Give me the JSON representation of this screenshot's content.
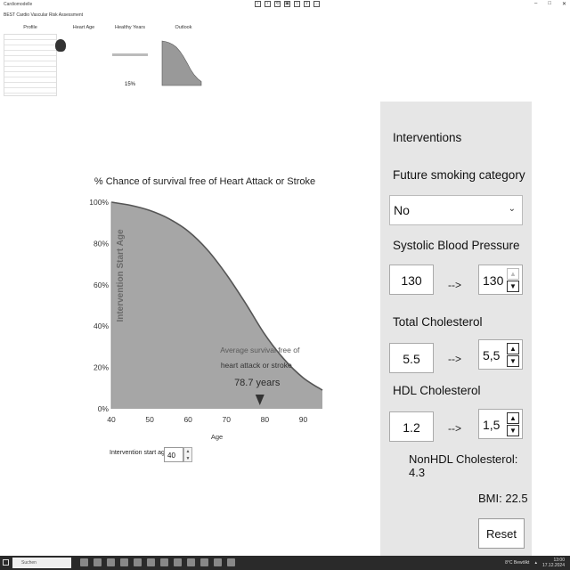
{
  "window": {
    "title": "Cardiomodelle",
    "subtitle": "BEST Cardio Vascular Risk Assessment"
  },
  "tabs": [
    {
      "label": "Profile"
    },
    {
      "label": "Heart Age"
    },
    {
      "label": "Healthy Years"
    },
    {
      "label": "Outlook"
    }
  ],
  "healthy_years": {
    "percent": "15%"
  },
  "chart": {
    "title": "% Chance of survival free of Heart Attack or Stroke",
    "yaxis_overlay": "Intervention Start Age",
    "xlabel": "Age",
    "annotation": {
      "line1": "Average survival free of",
      "line2": "heart attack or stroke",
      "value": "78.7 years"
    }
  },
  "chart_data": {
    "type": "area",
    "title": "% Chance of survival free of Heart Attack or Stroke",
    "xlabel": "Age",
    "ylabel": "",
    "xlim": [
      40,
      95
    ],
    "ylim": [
      0,
      100
    ],
    "x_ticks": [
      "40",
      "50",
      "60",
      "70",
      "80",
      "90"
    ],
    "y_ticks": [
      "0%",
      "20%",
      "40%",
      "60%",
      "80%",
      "100%"
    ],
    "x": [
      40,
      45,
      50,
      55,
      60,
      65,
      70,
      75,
      80,
      85,
      90,
      95
    ],
    "y": [
      100,
      98.5,
      96,
      92,
      86,
      77,
      65,
      51,
      36,
      24,
      15,
      9
    ],
    "marker_x": 78.7,
    "marker_label": "78.7 years",
    "colors": {
      "fill": "#a6a6a6",
      "line": "#555555"
    }
  },
  "intervention_start": {
    "label": "Intervention start age",
    "value": "40"
  },
  "panel": {
    "heading": "Interventions",
    "smoking": {
      "label": "Future smoking category",
      "value": "No"
    },
    "sbp": {
      "label": "Systolic Blood Pressure",
      "current": "130",
      "arrow": "-->",
      "target": "130"
    },
    "tc": {
      "label": "Total Cholesterol",
      "current": "5.5",
      "arrow": "-->",
      "target": "5,5"
    },
    "hdl": {
      "label": "HDL Cholesterol",
      "current": "1.2",
      "arrow": "-->",
      "target": "1,5"
    },
    "nonhdl": "NonHDL Cholesterol: 4.3",
    "bmi": "BMI: 22.5",
    "reset": "Reset"
  },
  "taskbar": {
    "search_placeholder": "Suchen",
    "weather": "8°C  Bewölkt",
    "time": "13:00",
    "date": "17.12.2024"
  }
}
